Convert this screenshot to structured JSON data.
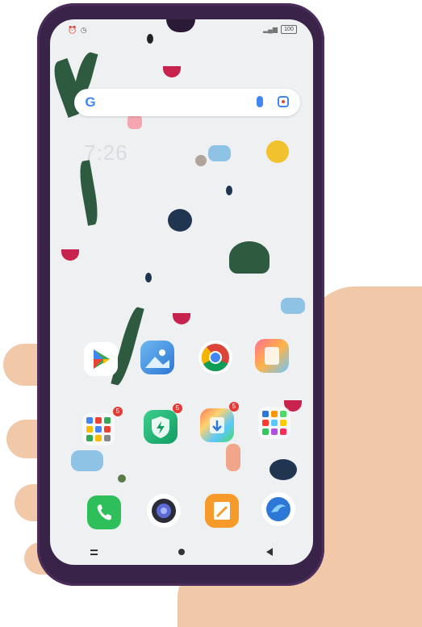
{
  "status_bar": {
    "left_icons": [
      "alarm-icon",
      "clock-icon"
    ],
    "battery": "100"
  },
  "search_widget": {
    "logo": "G",
    "icons": [
      "google-logo-icon",
      "mic-icon",
      "lens-icon"
    ]
  },
  "clock": {
    "time": "7:26"
  },
  "apps": {
    "row1": [
      "play-store-app",
      "gallery-app",
      "chrome-app",
      "themes-app"
    ],
    "row2": [
      "google-folder",
      "security-app",
      "cleaner-app",
      "tools-folder"
    ],
    "dock": [
      "phone-app",
      "camera-app",
      "notes-app",
      "browser-app"
    ]
  },
  "badges": {
    "google_folder": "5",
    "security": "5",
    "cleaner": "5"
  },
  "colors": {
    "phone_case": "#3a2348",
    "leaf": "#2e5b3f",
    "flower": "#c8234e",
    "wallpaper": "#eef0f2",
    "skin": "#f2c9a8"
  }
}
